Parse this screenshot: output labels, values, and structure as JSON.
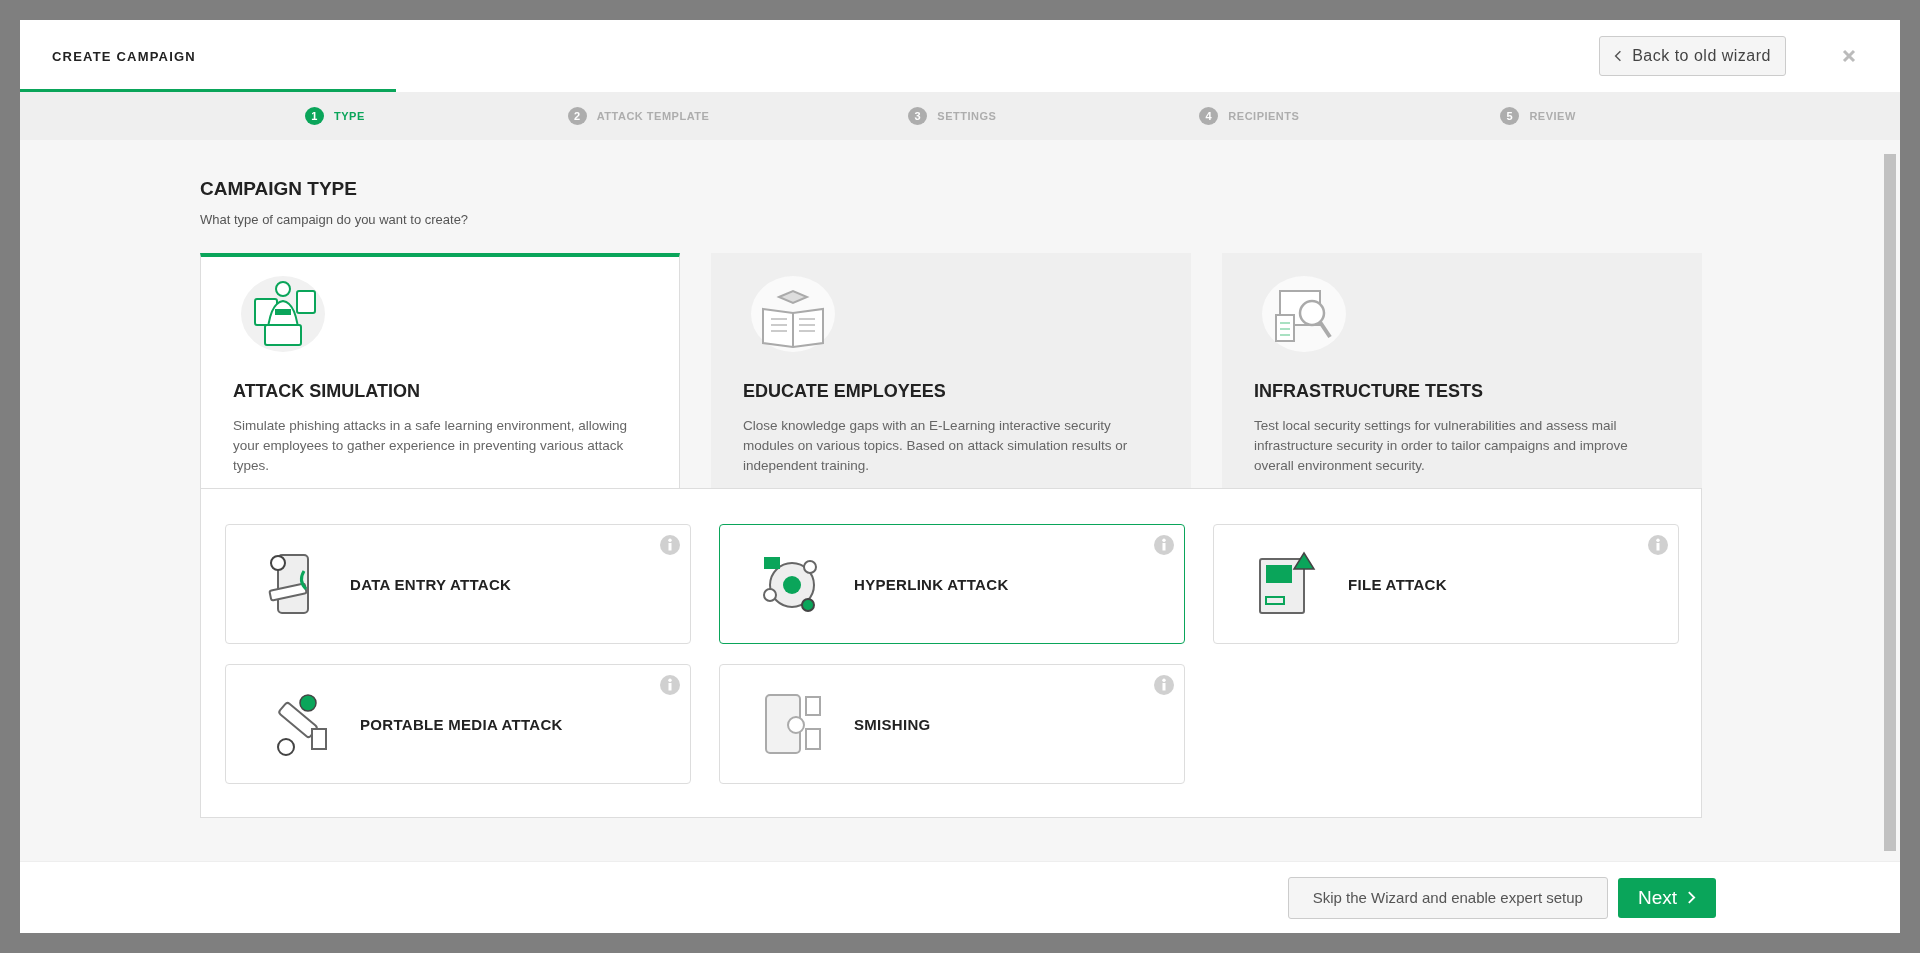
{
  "header": {
    "title": "CREATE CAMPAIGN",
    "back_button": "Back to old wizard",
    "progress": {
      "level": 0.2
    }
  },
  "steps": [
    {
      "number": "1",
      "label": "TYPE",
      "selected": true
    },
    {
      "number": "2",
      "label": "ATTACK TEMPLATE",
      "selected": false
    },
    {
      "number": "3",
      "label": "SETTINGS",
      "selected": false
    },
    {
      "number": "4",
      "label": "RECIPIENTS",
      "selected": false
    },
    {
      "number": "5",
      "label": "REVIEW",
      "selected": false
    }
  ],
  "section": {
    "title": "CAMPAIGN TYPE",
    "subtitle": "What type of campaign do you want to create?"
  },
  "campaign_types": [
    {
      "kind": "attack",
      "title": "ATTACK SIMULATION",
      "description": "Simulate phishing attacks in a safe learning environment, allowing your employees to gather experience in preventing various attack types.",
      "selected": true
    },
    {
      "kind": "educate",
      "title": "EDUCATE EMPLOYEES",
      "description": "Close knowledge gaps with an E-Learning interactive security modules on various topics. Based on attack simulation results or independent training.",
      "selected": false
    },
    {
      "kind": "infra",
      "title": "INFRASTRUCTURE TESTS",
      "description": "Test local security settings for vulnerabilities and assess mail infrastructure security in order to tailor campaigns and improve overall environment security.",
      "selected": false
    }
  ],
  "attack_types": [
    {
      "kind": "data_entry",
      "label": "DATA ENTRY ATTACK",
      "selected": false
    },
    {
      "kind": "hyperlink",
      "label": "HYPERLINK ATTACK",
      "selected": true
    },
    {
      "kind": "file",
      "label": "FILE ATTACK",
      "selected": false
    },
    {
      "kind": "portable",
      "label": "PORTABLE MEDIA ATTACK",
      "selected": false
    },
    {
      "kind": "smishing",
      "label": "SMISHING",
      "selected": false
    }
  ],
  "footer": {
    "skip_button": "Skip the Wizard and enable expert setup",
    "next_button": "Next"
  }
}
